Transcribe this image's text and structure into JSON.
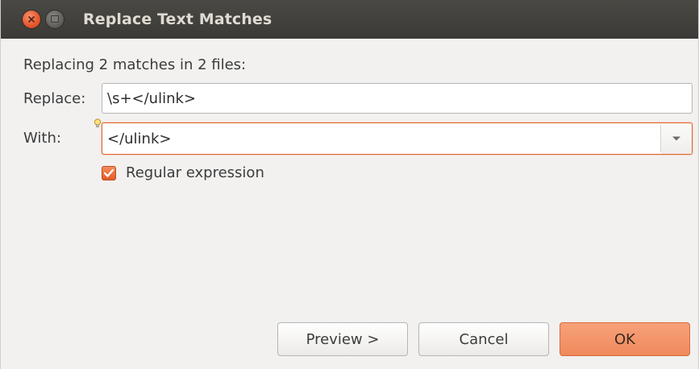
{
  "window": {
    "title": "Replace Text Matches"
  },
  "dialog": {
    "summary": "Replacing 2 matches in 2 files:",
    "replace_label": "Replace:",
    "replace_value": "\\s+</ulink>",
    "with_label": "With:",
    "with_value": "</ulink>",
    "regex_label": "Regular expression",
    "regex_checked": true
  },
  "buttons": {
    "preview": "Preview >",
    "cancel": "Cancel",
    "ok": "OK"
  },
  "icons": {
    "close": "close-icon",
    "minimize": "minimize-icon",
    "bulb": "lightbulb-icon",
    "dropdown": "chevron-down-icon",
    "check": "check-icon"
  },
  "colors": {
    "accent": "#e0672f",
    "titlebar": "#3c3b37",
    "ok_button": "#f0916a"
  }
}
